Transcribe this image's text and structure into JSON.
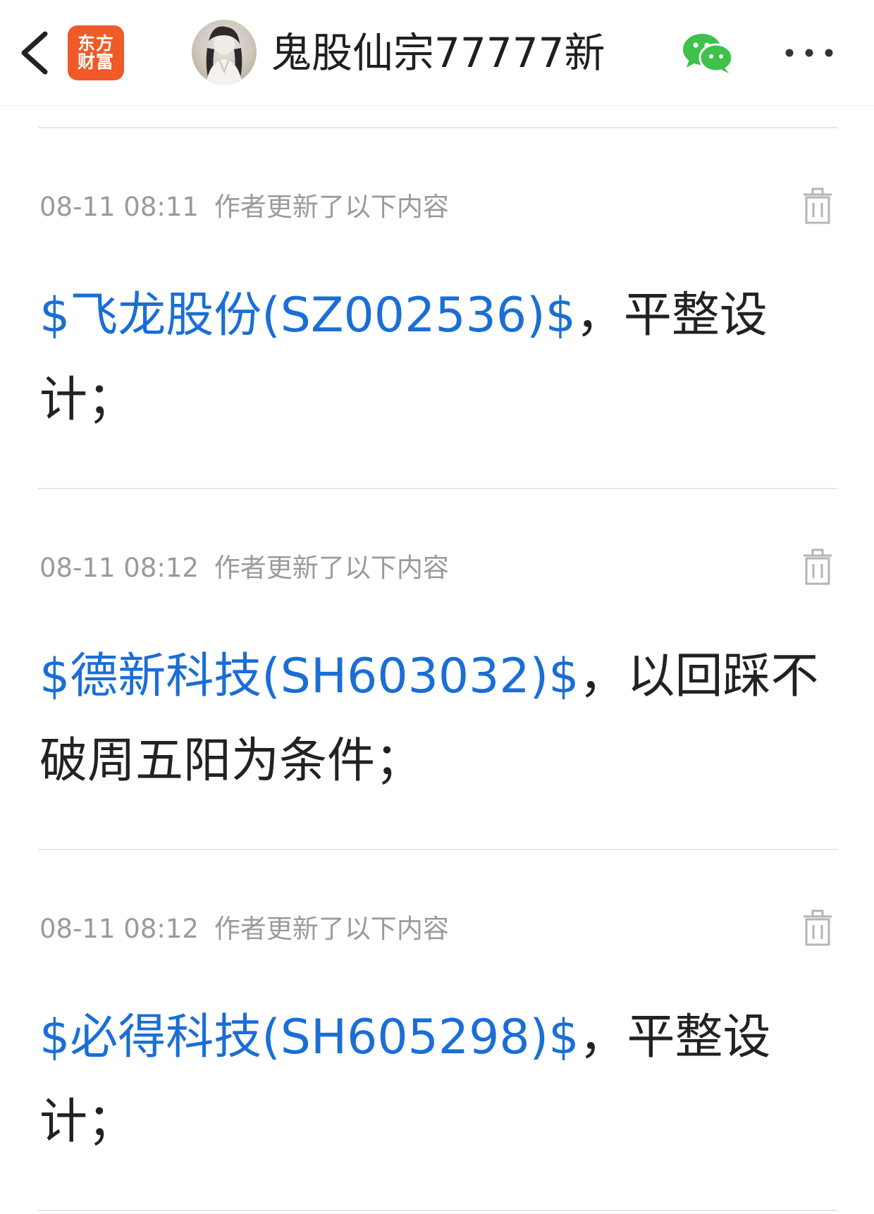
{
  "header": {
    "back_label": "back",
    "logo_top": "东方",
    "logo_bottom": "财富",
    "title": "鬼股仙宗77777新"
  },
  "posts": [
    {
      "time": "08-11 08:11",
      "meta": "作者更新了以下内容",
      "stock": "$飞龙股份(SZ002536)$",
      "text": "，平整设计；"
    },
    {
      "time": "08-11 08:12",
      "meta": "作者更新了以下内容",
      "stock": "$德新科技(SH603032)$",
      "text": "，以回踩不破周五阳为条件；"
    },
    {
      "time": "08-11 08:12",
      "meta": "作者更新了以下内容",
      "stock": "$必得科技(SH605298)$",
      "text": "，平整设计；"
    }
  ],
  "icons": {
    "back": "chevron-left-icon",
    "wechat": "wechat-icon",
    "more": "more-dots-icon",
    "delete": "trash-icon"
  },
  "colors": {
    "accent_link": "#1a6ed6",
    "logo_bg": "#ef5a28",
    "wechat_green": "#3fc14b",
    "meta_gray": "#9a9a9a"
  }
}
